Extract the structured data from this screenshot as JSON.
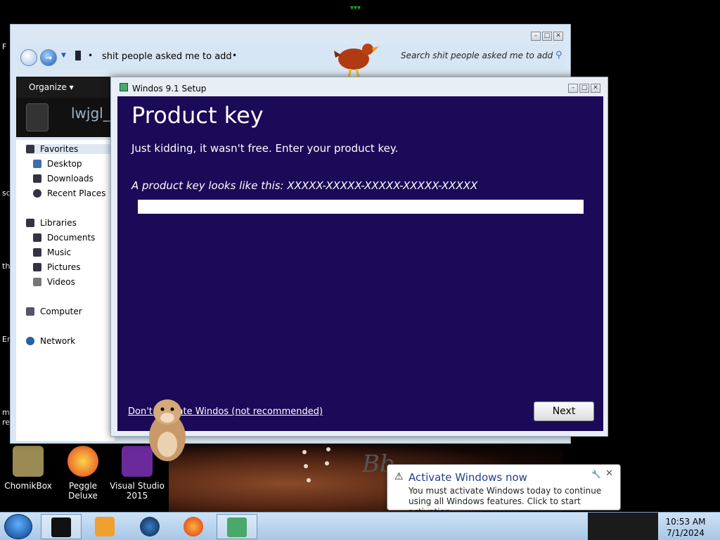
{
  "explorer": {
    "address_path": "shit people asked me to add",
    "search_placeholder": "Search shit people asked me to add",
    "organize_label": "Organize ▾",
    "folder_name": "lwjgl_u",
    "nav": {
      "favorites": "Favorites",
      "desktop": "Desktop",
      "downloads": "Downloads",
      "recent_places": "Recent Places",
      "libraries": "Libraries",
      "documents": "Documents",
      "music": "Music",
      "pictures": "Pictures",
      "videos": "Videos",
      "computer": "Computer",
      "network": "Network"
    }
  },
  "setup": {
    "window_title": "Windos 9.1 Setup",
    "heading": "Product key",
    "subtitle": "Just kidding, it wasn't free. Enter your product key.",
    "example": "A product key looks like this: XXXXX-XXXXX-XXXXX-XXXXX-XXXXX",
    "key_value": "",
    "skip_link": "Don't activate Windos (not recommended)",
    "next_label": "Next"
  },
  "desktop_icons": [
    {
      "label": "ChomikBox"
    },
    {
      "label": "Peggle Deluxe"
    },
    {
      "label": "Visual Studio 2015"
    }
  ],
  "edge_fragments": [
    "F",
    "sc",
    "th",
    "Er",
    "m",
    "re"
  ],
  "balloon": {
    "title": "Activate Windows now",
    "text": "You must activate Windows today to continue using all Windows features. Click to start activation.",
    "close_glyph": "✕",
    "pin_glyph": "🔧"
  },
  "clock": {
    "time": "10:53 AM",
    "date": "7/1/2024"
  },
  "colors": {
    "setup_bg": "#1b0a57",
    "balloon_title": "#1f3f8f"
  }
}
